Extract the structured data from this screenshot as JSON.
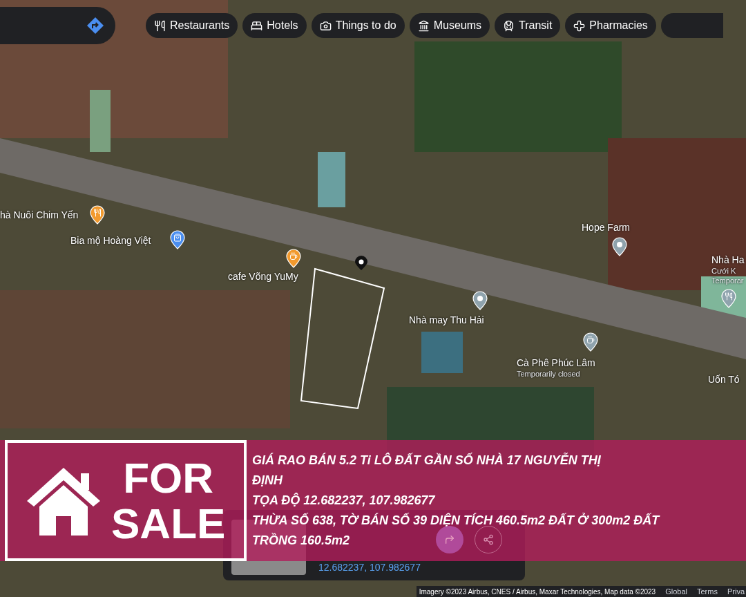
{
  "categories": [
    {
      "label": "Restaurants",
      "kind": "fork"
    },
    {
      "label": "Hotels",
      "kind": "bed"
    },
    {
      "label": "Things to do",
      "kind": "camera"
    },
    {
      "label": "Museums",
      "kind": "museum"
    },
    {
      "label": "Transit",
      "kind": "train"
    },
    {
      "label": "Pharmacies",
      "kind": "pharmacy"
    }
  ],
  "places": [
    {
      "lines": [
        "hà Nuôi Chim Yến"
      ],
      "kind": "fork",
      "color": "#f29a2e"
    },
    {
      "lines": [
        "Bia mộ Hoàng Việt"
      ],
      "kind": "bag",
      "color": "#4a8ef0"
    },
    {
      "lines": [
        "cafe Võng YuMy"
      ],
      "kind": "cup",
      "color": "#f29a2e"
    },
    {
      "lines": [
        "Hope Farm"
      ],
      "kind": "dot",
      "color": "#8fa3ad"
    },
    {
      "lines": [
        "Nhà may Thu Hải"
      ],
      "kind": "dot",
      "color": "#8fa3ad"
    },
    {
      "lines": [
        "Cà Phê Phúc Lâm",
        "Temporarily closed"
      ],
      "kind": "cup",
      "color": "#8fa3ad"
    },
    {
      "lines": [
        "Nhà Ha",
        "Cưới K",
        "Temporar"
      ],
      "kind": "fork",
      "color": "#8fa3ad"
    },
    {
      "lines": [
        "Uốn Tó"
      ],
      "kind": "none"
    }
  ],
  "place_card": {
    "coordinates": "12.682237, 107.982677"
  },
  "banner": {
    "sign": [
      "FOR",
      "SALE"
    ],
    "lines": [
      "GIÁ RAO BÁN 5.2 Ti LÔ ĐẤT GẦN SỐ NHÀ 17 NGUYỄN THỊ",
      "ĐỊNH",
      "TỌA ĐỘ 12.682237, 107.982677",
      "THỪA SỐ 638, TỜ BÁN SỐ 39 DIỆN TÍCH 460.5m2 ĐẤT Ở 300m2 ĐẤT",
      "TRỒNG 160.5m2"
    ]
  },
  "footer": {
    "attribution": "Imagery ©2023 Airbus, CNES / Airbus, Maxar Technologies, Map data ©2023",
    "links": [
      "Global",
      "Terms",
      "Priva"
    ]
  }
}
